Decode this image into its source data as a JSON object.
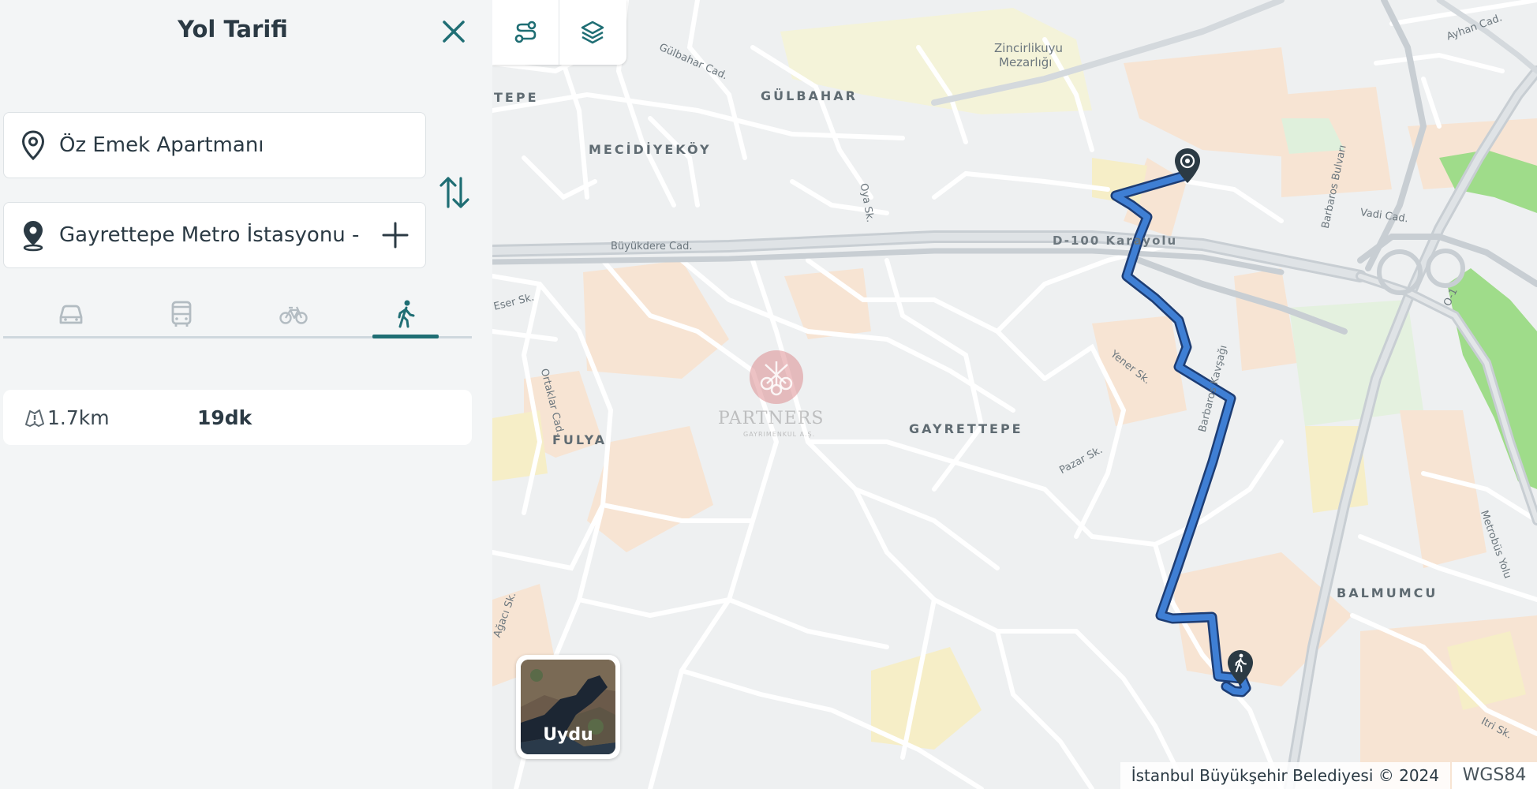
{
  "panel": {
    "title": "Yol Tarifi",
    "origin": {
      "value": "Öz Emek Apartmanı",
      "icon": "location-pin-icon"
    },
    "destination": {
      "value": "Gayrettepe Metro İstasyonu -",
      "icon": "location-pin-filled-icon"
    },
    "modes": [
      {
        "name": "car",
        "icon": "car-icon",
        "active": false
      },
      {
        "name": "bus",
        "icon": "bus-icon",
        "active": false
      },
      {
        "name": "bicycle",
        "icon": "bicycle-icon",
        "active": false
      },
      {
        "name": "walk",
        "icon": "walking-icon",
        "active": true
      }
    ],
    "summary": {
      "distance": "1.7km",
      "duration": "19dk"
    }
  },
  "map": {
    "satellite_label": "Uydu",
    "attribution": "İstanbul Büyükşehir Belediyesi © 2024",
    "projection": "WGS84",
    "watermark": {
      "name": "PARTNERS",
      "sub": "GAYRIMENKUL A.Ş."
    },
    "districts": [
      "GÜLBAHAR",
      "MECİDİYEKÖY",
      "FULYA",
      "GAYRETTEPE",
      "BALMUMCU",
      "TEPE"
    ],
    "places": [
      "Zincirlikuyu",
      "Mezarlığı"
    ],
    "streets": [
      "Büyükdere Cad.",
      "D-100 Karayolu",
      "O-1",
      "Yener Sk.",
      "Pazar Sk.",
      "Barbaros Kavşağı",
      "Barbaros Bulvarı",
      "Vadi Cad.",
      "Metrobüs Yolu",
      "Ortaklar Cad.",
      "Itri Sk.",
      "Ayhan Cad.",
      "Eser Sk.",
      "Gülbahar Cad.",
      "Oya Sk.",
      "Ağacı Sk."
    ],
    "route_color": "#3f7fd4",
    "accent_color": "#1f6e74"
  }
}
